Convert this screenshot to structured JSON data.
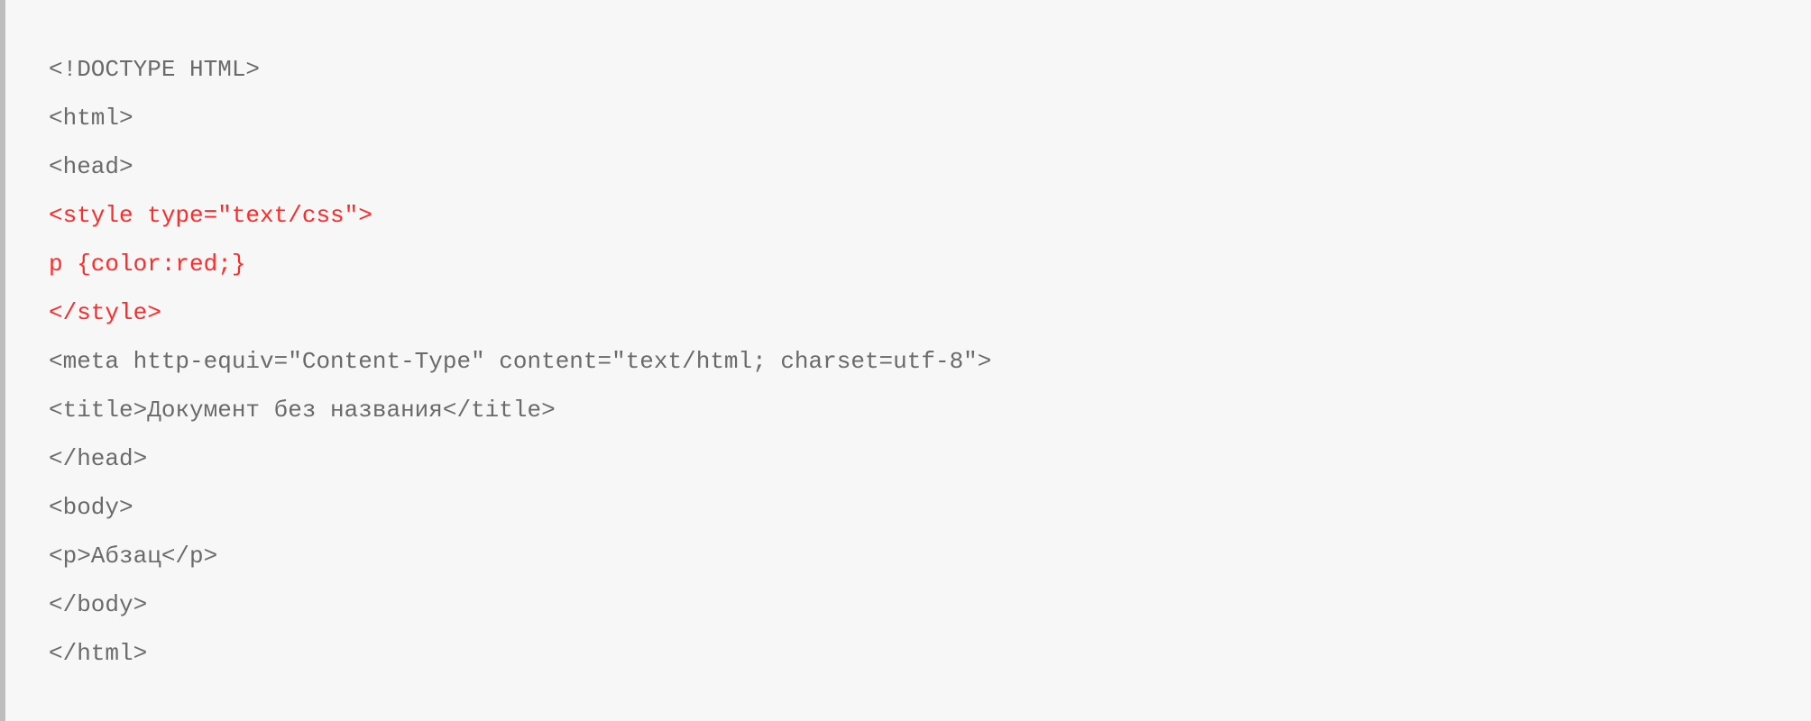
{
  "code": {
    "lines": [
      {
        "text": "<!DOCTYPE HTML>",
        "highlight": false
      },
      {
        "text": "<html>",
        "highlight": false
      },
      {
        "text": "<head>",
        "highlight": false
      },
      {
        "text": "<style type=\"text/css\">",
        "highlight": true
      },
      {
        "text": "p {color:red;}",
        "highlight": true
      },
      {
        "text": "</style>",
        "highlight": true
      },
      {
        "text": "<meta http-equiv=\"Content-Type\" content=\"text/html; charset=utf-8\">",
        "highlight": false
      },
      {
        "text": "<title>Документ без названия</title>",
        "highlight": false
      },
      {
        "text": "</head>",
        "highlight": false
      },
      {
        "text": "<body>",
        "highlight": false
      },
      {
        "text": "<p>Абзац</p>",
        "highlight": false
      },
      {
        "text": "</body>",
        "highlight": false
      },
      {
        "text": "</html>",
        "highlight": false
      }
    ]
  }
}
